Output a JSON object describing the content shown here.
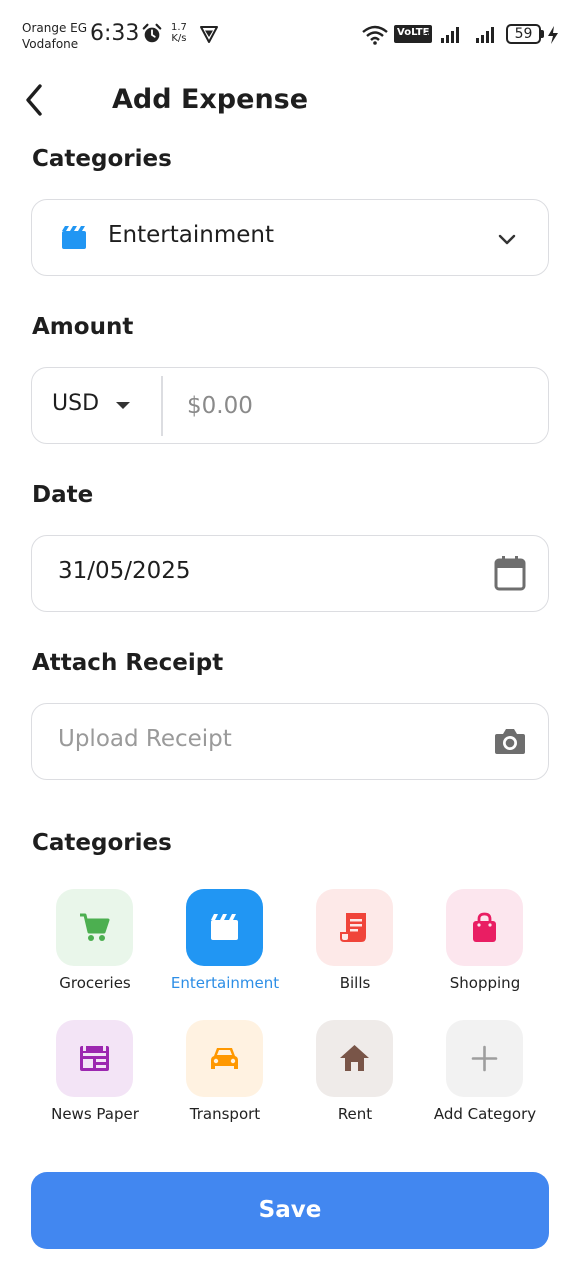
{
  "status_bar": {
    "carrier_1": "Orange EG",
    "carrier_2": "Vodafone",
    "time": "6:33",
    "speed_value": "1.7",
    "speed_unit": "K/s",
    "volte": "VoLTE",
    "volte_sub": "2",
    "battery": "59"
  },
  "header": {
    "title": "Add Expense",
    "back_icon": "chevron-left-icon"
  },
  "form": {
    "category_label": "Categories",
    "category_value": "Entertainment",
    "category_icon": "clapperboard-icon",
    "amount_label": "Amount",
    "currency": "USD",
    "amount_placeholder": "$0.00",
    "date_label": "Date",
    "date_value": "31/05/2025",
    "receipt_label": "Attach Receipt",
    "receipt_placeholder": "Upload Receipt"
  },
  "category_grid": {
    "title": "Categories",
    "items": [
      {
        "label": "Groceries",
        "icon": "cart-icon",
        "color": "#4caf50",
        "bg": "#e9f6ea",
        "selected": false
      },
      {
        "label": "Entertainment",
        "icon": "clapperboard-icon",
        "color": "#ffffff",
        "bg": "#2196f3",
        "selected": true
      },
      {
        "label": "Bills",
        "icon": "receipt-icon",
        "color": "#f0443a",
        "bg": "#fde9e8",
        "selected": false
      },
      {
        "label": "Shopping",
        "icon": "shopping-bag-icon",
        "color": "#e91e63",
        "bg": "#fce6ee",
        "selected": false
      },
      {
        "label": "News Paper",
        "icon": "newspaper-icon",
        "color": "#9c27b0",
        "bg": "#f3e4f6",
        "selected": false
      },
      {
        "label": "Transport",
        "icon": "car-icon",
        "color": "#ff9800",
        "bg": "#fff2e1",
        "selected": false
      },
      {
        "label": "Rent",
        "icon": "home-icon",
        "color": "#795548",
        "bg": "#efebe9",
        "selected": false
      },
      {
        "label": "Add Category",
        "icon": "plus-icon",
        "color": "#9e9e9e",
        "bg": "#f2f2f2",
        "selected": false
      }
    ]
  },
  "save_label": "Save",
  "colors": {
    "primary": "#4287f0",
    "accent": "#2196f3",
    "border": "#dcdde1"
  }
}
